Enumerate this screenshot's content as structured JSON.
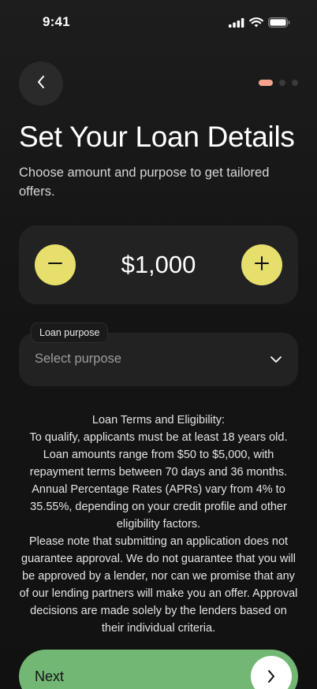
{
  "status_bar": {
    "time": "9:41",
    "icons": [
      "cellular-signal-icon",
      "wifi-icon",
      "battery-icon"
    ]
  },
  "header": {
    "back_icon": "chevron-left-icon",
    "pagination": {
      "total": 3,
      "current": 1,
      "active_color": "#f4a48d"
    }
  },
  "page": {
    "title": "Set Your Loan Details",
    "subtitle": "Choose amount and purpose to get tailored offers."
  },
  "amount": {
    "value": "$1,000",
    "decrement_icon": "minus-icon",
    "increment_icon": "plus-icon",
    "accent_color": "#e7df6c"
  },
  "purpose": {
    "label": "Loan purpose",
    "placeholder": "Select purpose",
    "icon": "chevron-down-icon"
  },
  "terms": {
    "lines": [
      "Loan Terms and Eligibility:",
      "To qualify, applicants must be at least 18 years old. Loan amounts range from $50 to $5,000, with repayment terms between 70 days and 36 months. Annual Percentage Rates (APRs) vary from 4% to 35.55%, depending on your credit profile and other eligibility factors.",
      "Please note that submitting an application does not guarantee approval. We do not guarantee that you will be approved by a lender, nor can we promise that any of our lending partners will make you an offer. Approval decisions are made solely by the lenders based on their individual criteria."
    ]
  },
  "footer": {
    "next_label": "Next",
    "next_icon": "chevron-right-icon",
    "button_color": "#72b874"
  }
}
